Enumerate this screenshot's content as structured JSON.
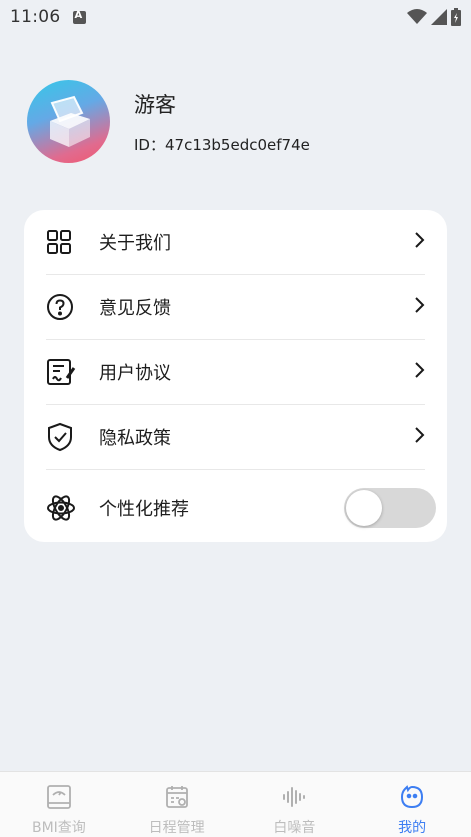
{
  "status_bar": {
    "time": "11:06"
  },
  "profile": {
    "name": "游客",
    "id_label": "ID：",
    "id_value": "47c13b5edc0ef74e"
  },
  "menu": {
    "items": [
      {
        "label": "关于我们",
        "icon": "grid-icon"
      },
      {
        "label": "意见反馈",
        "icon": "question-icon"
      },
      {
        "label": "用户协议",
        "icon": "document-edit-icon"
      },
      {
        "label": "隐私政策",
        "icon": "shield-check-icon"
      }
    ],
    "toggle_item": {
      "label": "个性化推荐",
      "icon": "atom-icon",
      "enabled": false
    }
  },
  "bottom_nav": {
    "items": [
      {
        "label": "BMI查询",
        "icon": "scale-icon",
        "active": false
      },
      {
        "label": "日程管理",
        "icon": "calendar-icon",
        "active": false
      },
      {
        "label": "白噪音",
        "icon": "sound-wave-icon",
        "active": false
      },
      {
        "label": "我的",
        "icon": "smile-face-icon",
        "active": true
      }
    ]
  },
  "colors": {
    "accent": "#3d7ef2",
    "background": "#edf0f4",
    "inactive": "#bdbdbd"
  }
}
